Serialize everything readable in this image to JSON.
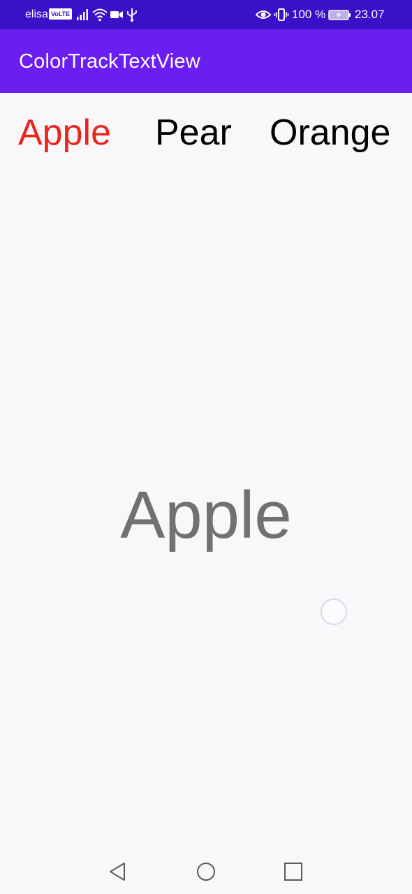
{
  "status_bar": {
    "carrier": "elisa",
    "volte_badge": "VoLTE",
    "battery_percent": "100 %",
    "time": "23.07",
    "icons": [
      "signal-icon",
      "wifi-icon",
      "video-icon",
      "usb-icon",
      "eye-icon",
      "vibrate-icon",
      "battery-charging-icon"
    ],
    "background": "#3a10c9"
  },
  "app_bar": {
    "title": "ColorTrackTextView",
    "background": "#6a1ef2"
  },
  "tabs": [
    {
      "label": "Apple",
      "color": "#e8261c"
    },
    {
      "label": "Pear",
      "color": "#000000"
    },
    {
      "label": "Orange",
      "color": "#000000"
    }
  ],
  "main": {
    "center_label": "Apple",
    "center_label_color": "#717171"
  },
  "navigation_bar": {
    "buttons": [
      "back-icon",
      "home-icon",
      "recents-icon"
    ]
  }
}
